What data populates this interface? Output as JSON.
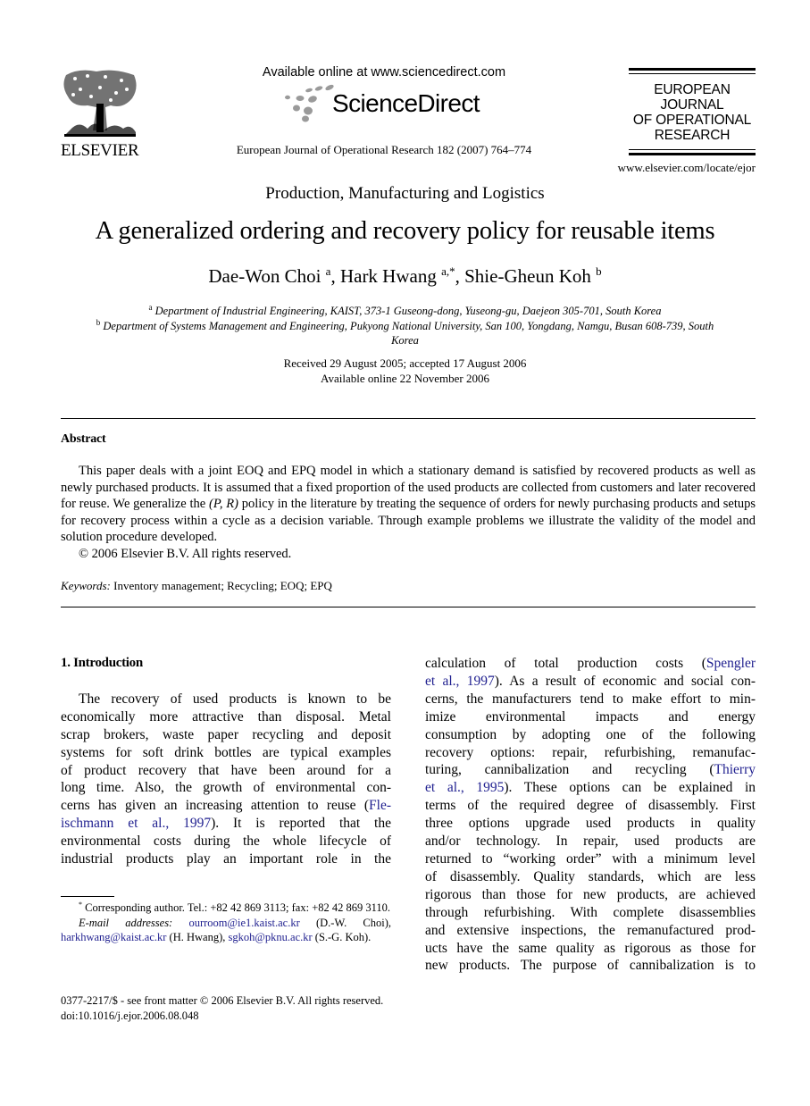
{
  "header": {
    "publisher_name": "ELSEVIER",
    "available_online": "Available online at www.sciencedirect.com",
    "sciencedirect_brand": "ScienceDirect",
    "journal_reference": "European Journal of Operational Research 182 (2007) 764–774",
    "journal_logo_lines": [
      "EUROPEAN",
      "JOURNAL",
      "OF OPERATIONAL",
      "RESEARCH"
    ],
    "journal_url": "www.elsevier.com/locate/ejor"
  },
  "article": {
    "section": "Production, Manufacturing and Logistics",
    "title": "A generalized ordering and recovery policy for reusable items",
    "authors": [
      {
        "name": "Dae-Won Choi",
        "marks": "a"
      },
      {
        "name": "Hark Hwang",
        "marks": "a,*"
      },
      {
        "name": "Shie-Gheun Koh",
        "marks": "b"
      }
    ],
    "affiliations": [
      {
        "mark": "a",
        "text": "Department of Industrial Engineering, KAIST, 373-1 Guseong-dong, Yuseong-gu, Daejeon 305-701, South Korea"
      },
      {
        "mark": "b",
        "text": "Department of Systems Management and Engineering, Pukyong National University, San 100, Yongdang, Namgu, Busan 608-739, South Korea"
      }
    ],
    "received": "Received 29 August 2005; accepted 17 August 2006",
    "available": "Available online 22 November 2006"
  },
  "abstract": {
    "heading": "Abstract",
    "body_before": "This paper deals with a joint EOQ and EPQ model in which a stationary demand is satisfied by recovered products as well as newly purchased products. It is assumed that a fixed proportion of the used products are collected from customers and later recovered for reuse. We generalize the ",
    "policy": "(P, R)",
    "body_after": " policy in the literature by treating the sequence of orders for newly purchasing products and setups for recovery process within a cycle as a decision variable. Through example problems we illustrate the validity of the model and solution procedure developed.",
    "copyright": "© 2006 Elsevier B.V. All rights reserved.",
    "keywords_label": "Keywords:",
    "keywords": "Inventory management; Recycling; EOQ; EPQ"
  },
  "introduction": {
    "heading": "1. Introduction",
    "left_lines": [
      "The recovery of used products is known to be",
      "economically more attractive than disposal. Metal",
      "scrap brokers, waste paper recycling and deposit",
      "systems for soft drink bottles are typical examples",
      "of product recovery that have been around for a",
      "long time. Also, the growth of environmental con-",
      "cerns has given an increasing attention to reuse (",
      "ischmann et al., 1997",
      "). It is reported that the",
      "environmental costs during the whole lifecycle of",
      "industrial products play an important role in the"
    ],
    "left_cite_1a": "Fle-",
    "right_lines": [
      "calculation of total production costs (",
      "Spengler",
      "et al., 1997",
      "). As a result of economic and social con-",
      "cerns, the manufacturers tend to make effort to min-",
      "imize environmental impacts and energy",
      "consumption by adopting one of the following",
      "recovery options: repair, refurbishing, remanufac-",
      "turing, cannibalization and recycling (",
      "Thierry",
      "et al., 1995",
      "). These options can be explained in",
      "terms of the required degree of disassembly. First",
      "three options upgrade used products in quality",
      "and/or technology. In repair, used products are",
      "returned to “working order” with a minimum level",
      "of disassembly. Quality standards, which are less",
      "rigorous than those for new products, are achieved",
      "through refurbishing. With complete disassemblies",
      "and extensive inspections, the remanufactured prod-",
      "ucts have the same quality as rigorous as those for",
      "new products. The purpose of cannibalization is to"
    ]
  },
  "footnotes": {
    "mark": "*",
    "corresponding": "Corresponding author. Tel.: +82 42 869 3113; fax: +82 42 869 3110.",
    "email_label": "E-mail addresses:",
    "emails": [
      {
        "address": "ourroom@ie1.kaist.ac.kr",
        "who": "(D.-W. Choi),"
      },
      {
        "address": "harkhwang@kaist.ac.kr",
        "who": "(H. Hwang),"
      },
      {
        "address": "sgkoh@pknu.ac.kr",
        "who": "(S.-G. Koh)."
      }
    ]
  },
  "bottom_meta": {
    "issn": "0377-2217/$ - see front matter © 2006 Elsevier B.V. All rights reserved.",
    "doi": "doi:10.1016/j.ejor.2006.08.048"
  },
  "colors": {
    "link": "#1f1f8f",
    "sciencedirect_dots": "#9a9a9a"
  }
}
